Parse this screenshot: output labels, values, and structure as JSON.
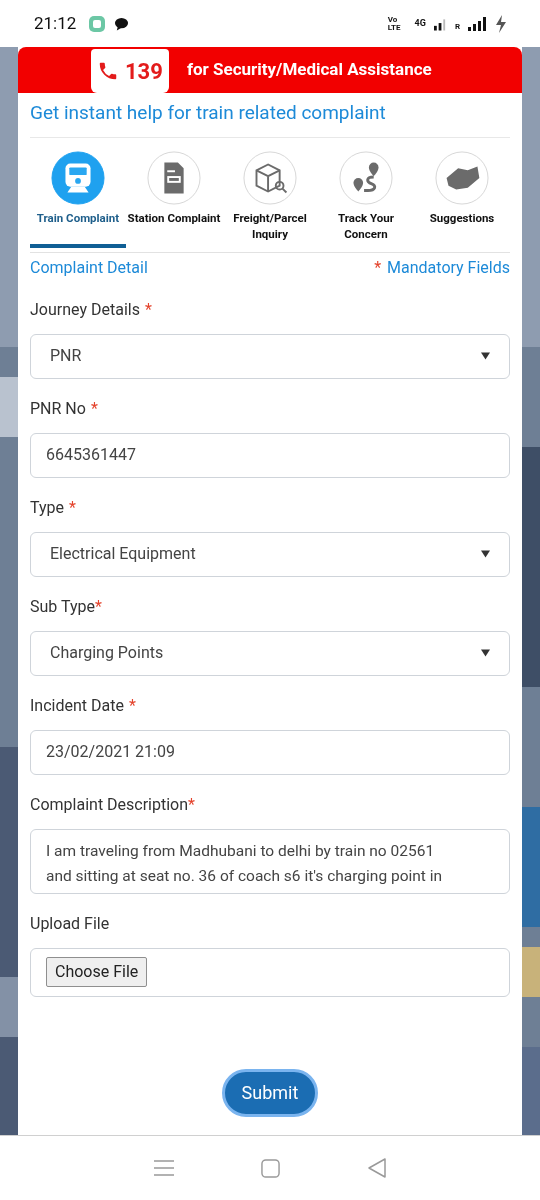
{
  "status_bar": {
    "time": "21:12",
    "network_labels": [
      "Vo",
      "LTE",
      "4G",
      "R"
    ]
  },
  "helpline": {
    "number": "139",
    "text": "for Security/Medical Assistance"
  },
  "title": "Get instant help for train related complaint",
  "tabs": [
    {
      "label": "Train Complaint",
      "selected": true
    },
    {
      "label": "Station Complaint",
      "selected": false
    },
    {
      "label": "Freight/Parcel Inquiry",
      "selected": false
    },
    {
      "label": "Track Your Concern",
      "selected": false
    },
    {
      "label": "Suggestions",
      "selected": false
    }
  ],
  "section": {
    "title": "Complaint Detail",
    "mandatory_mark": "*",
    "mandatory_text": "Mandatory Fields"
  },
  "fields": [
    {
      "kind": "select",
      "label": "Journey Details",
      "mark": "*",
      "mark_spaced": true,
      "value": "PNR"
    },
    {
      "kind": "text",
      "label": "PNR No",
      "mark": "*",
      "mark_spaced": true,
      "value": "6645361447"
    },
    {
      "kind": "select",
      "label": "Type",
      "mark": "*",
      "mark_spaced": true,
      "value": "Electrical Equipment"
    },
    {
      "kind": "select",
      "label": "Sub Type",
      "mark": "*",
      "mark_spaced": false,
      "value": "Charging Points"
    },
    {
      "kind": "text",
      "label": "Incident Date",
      "mark": "*",
      "mark_spaced": true,
      "value": "23/02/2021 21:09"
    },
    {
      "kind": "textarea",
      "label": "Complaint Description",
      "mark": "*",
      "mark_spaced": false,
      "lines": [
        "I am traveling from Madhubani to delhi by train no 02561",
        "and sitting at seat no. 36 of coach s6 it's charging point in"
      ]
    },
    {
      "kind": "file",
      "label": "Upload File",
      "button": "Choose File"
    }
  ],
  "submit": "Submit"
}
